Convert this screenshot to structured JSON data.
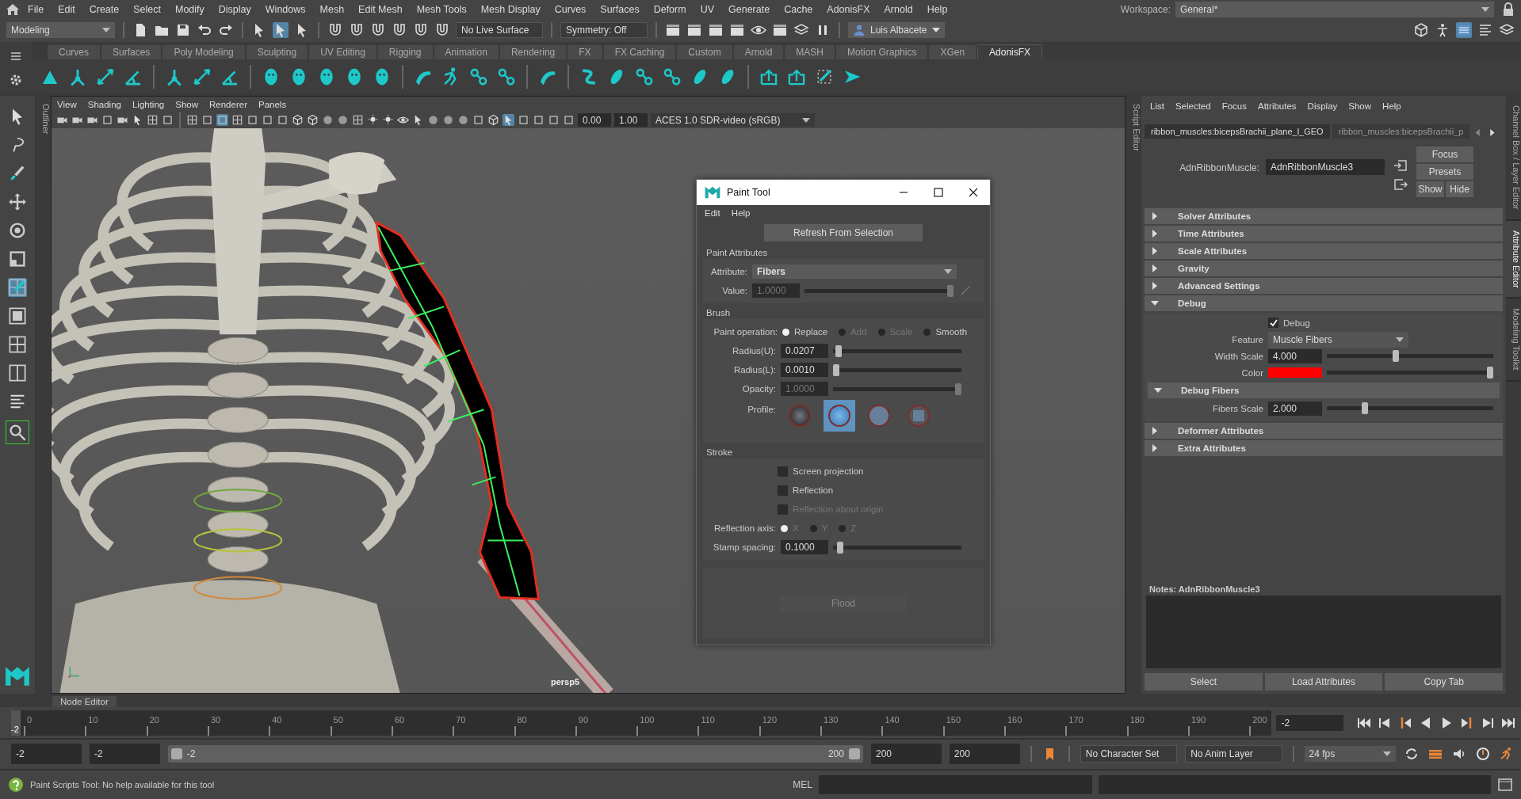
{
  "menu_bar": {
    "items": [
      "File",
      "Edit",
      "Create",
      "Select",
      "Modify",
      "Display",
      "Windows",
      "Mesh",
      "Edit Mesh",
      "Mesh Tools",
      "Mesh Display",
      "Curves",
      "Surfaces",
      "Deform",
      "UV",
      "Generate",
      "Cache",
      "AdonisFX",
      "Arnold",
      "Help"
    ]
  },
  "workspace": {
    "label": "Workspace:",
    "value": "General*"
  },
  "status_line": {
    "mode": "Modeling",
    "live_surface": "No Live Surface",
    "symmetry": "Symmetry: Off",
    "user": "Luis Albacete"
  },
  "shelf": {
    "tabs": [
      {
        "label": "Curves",
        "selected": false
      },
      {
        "label": "Surfaces",
        "selected": false
      },
      {
        "label": "Poly Modeling",
        "selected": false
      },
      {
        "label": "Sculpting",
        "selected": false
      },
      {
        "label": "UV Editing",
        "selected": false
      },
      {
        "label": "Rigging",
        "selected": false
      },
      {
        "label": "Animation",
        "selected": false
      },
      {
        "label": "Rendering",
        "selected": false
      },
      {
        "label": "FX",
        "selected": false
      },
      {
        "label": "FX Caching",
        "selected": false
      },
      {
        "label": "Custom",
        "selected": false
      },
      {
        "label": "Arnold",
        "selected": false
      },
      {
        "label": "MASH",
        "selected": false
      },
      {
        "label": "Motion Graphics",
        "selected": false
      },
      {
        "label": "XGen",
        "selected": false
      },
      {
        "label": "AdonisFX",
        "selected": true
      }
    ]
  },
  "outliner_tab": "Outliner",
  "viewport": {
    "menu": [
      "View",
      "Shading",
      "Lighting",
      "Show",
      "Renderer",
      "Panels"
    ],
    "exposure": "0.00",
    "gamma": "1.00",
    "color_space": "ACES 1.0 SDR-video (sRGB)",
    "camera": "persp5"
  },
  "paint_tool": {
    "title": "Paint Tool",
    "menu": [
      "Edit",
      "Help"
    ],
    "refresh_button": "Refresh From Selection",
    "paint_attributes": {
      "title": "Paint Attributes",
      "attribute_label": "Attribute:",
      "attribute": "Fibers",
      "value_slider": {
        "label": "Value:",
        "value": "1.0000",
        "level": 1,
        "disabled": true
      }
    },
    "brush": {
      "title": "Brush",
      "operation_label": "Paint operation:",
      "operations": [
        {
          "label": "Replace",
          "selected": true,
          "disabled": false
        },
        {
          "label": "Add",
          "selected": false,
          "disabled": true
        },
        {
          "label": "Scale",
          "selected": false,
          "disabled": true
        },
        {
          "label": "Smooth",
          "selected": false,
          "disabled": false
        }
      ],
      "sliders": [
        {
          "label": "Radius(U):",
          "value": "0.0207",
          "level": 0.02,
          "disabled": false
        },
        {
          "label": "Radius(L):",
          "value": "0.0010",
          "level": 0,
          "disabled": false
        },
        {
          "label": "Opacity:",
          "value": "1.0000",
          "level": 1,
          "disabled": true
        }
      ],
      "profile_label": "Profile:",
      "profiles": [
        {
          "kind": "soft",
          "selected": false
        },
        {
          "kind": "gaussian",
          "selected": true
        },
        {
          "kind": "solid",
          "selected": false
        },
        {
          "kind": "square",
          "selected": false
        }
      ]
    },
    "stroke": {
      "title": "Stroke",
      "options": [
        {
          "label": "Screen projection",
          "checked": false,
          "disabled": false
        },
        {
          "label": "Reflection",
          "checked": false,
          "disabled": false
        },
        {
          "label": "Reflection about origin",
          "checked": false,
          "disabled": true
        }
      ],
      "axis_label": "Reflection axis:",
      "axes": [
        {
          "label": "X",
          "selected": true,
          "disabled": true
        },
        {
          "label": "Y",
          "selected": false,
          "disabled": true
        },
        {
          "label": "Z",
          "selected": false,
          "disabled": true
        }
      ],
      "stamp_spacing": {
        "label": "Stamp spacing:",
        "value": "0.1000",
        "level": 0.03
      }
    },
    "flood_button": {
      "label": "Flood",
      "disabled": true
    }
  },
  "script_editor_tab": "Script Editor",
  "attribute_editor": {
    "menu": [
      "List",
      "Selected",
      "Focus",
      "Attributes",
      "Display",
      "Show",
      "Help"
    ],
    "tabs": [
      {
        "label": "ribbon_muscles:bicepsBrachii_plane_l_GEO",
        "selected": true
      },
      {
        "label": "ribbon_muscles:bicepsBrachii_p",
        "selected": false
      }
    ],
    "node_label": "AdnRibbonMuscle:",
    "node_name": "AdnRibbonMuscle3",
    "buttons": [
      "Focus",
      "Presets",
      "Show",
      "Hide"
    ],
    "sections": [
      {
        "title": "Solver Attributes",
        "expanded": false
      },
      {
        "title": "Time Attributes",
        "expanded": false
      },
      {
        "title": "Scale Attributes",
        "expanded": false
      },
      {
        "title": "Gravity",
        "expanded": false
      },
      {
        "title": "Advanced Settings",
        "expanded": false
      },
      {
        "title": "Debug",
        "expanded": true,
        "fields": [
          {
            "kind": "checkbox",
            "label": "Debug",
            "checked": true
          },
          {
            "kind": "dropdown",
            "label": "Feature",
            "value": "Muscle Fibers"
          },
          {
            "kind": "slider",
            "label": "Width Scale",
            "value": "4.000",
            "level": 0.41
          },
          {
            "kind": "color",
            "label": "Color",
            "color": "#ff0000",
            "level": 1
          },
          {
            "kind": "subsection",
            "title": "Debug Fibers",
            "expanded": true,
            "fields": [
              {
                "kind": "slider",
                "label": "Fibers Scale",
                "value": "2.000",
                "level": 0.22
              }
            ]
          }
        ]
      },
      {
        "title": "Deformer Attributes",
        "expanded": false
      },
      {
        "title": "Extra Attributes",
        "expanded": false
      }
    ],
    "notes_label": "Notes:  AdnRibbonMuscle3",
    "bottom_buttons": [
      "Select",
      "Load Attributes",
      "Copy Tab"
    ]
  },
  "right_tabs": [
    {
      "label": "Channel Box / Layer Editor",
      "selected": false
    },
    {
      "label": "Attribute Editor",
      "selected": true
    },
    {
      "label": "Modeling Toolkit",
      "selected": false
    }
  ],
  "node_editor_tab": "Node Editor",
  "time_slider": {
    "ticks": [
      "0",
      "10",
      "20",
      "30",
      "40",
      "50",
      "60",
      "70",
      "80",
      "90",
      "100",
      "110",
      "120",
      "130",
      "140",
      "150",
      "160",
      "170",
      "180",
      "190",
      "200"
    ],
    "current_frame": "-2",
    "frame_field": "-2"
  },
  "range_slider": {
    "start": "-2",
    "playback_start": "-2",
    "slider_start": "-2",
    "slider_end": "200",
    "playback_end": "200",
    "end": "200",
    "character_set": "No Character Set",
    "anim_layer": "No Anim Layer",
    "fps": "24 fps"
  },
  "command_line": {
    "language": "MEL"
  },
  "help_line": {
    "text": "Paint Scripts Tool: No help available for this tool"
  }
}
